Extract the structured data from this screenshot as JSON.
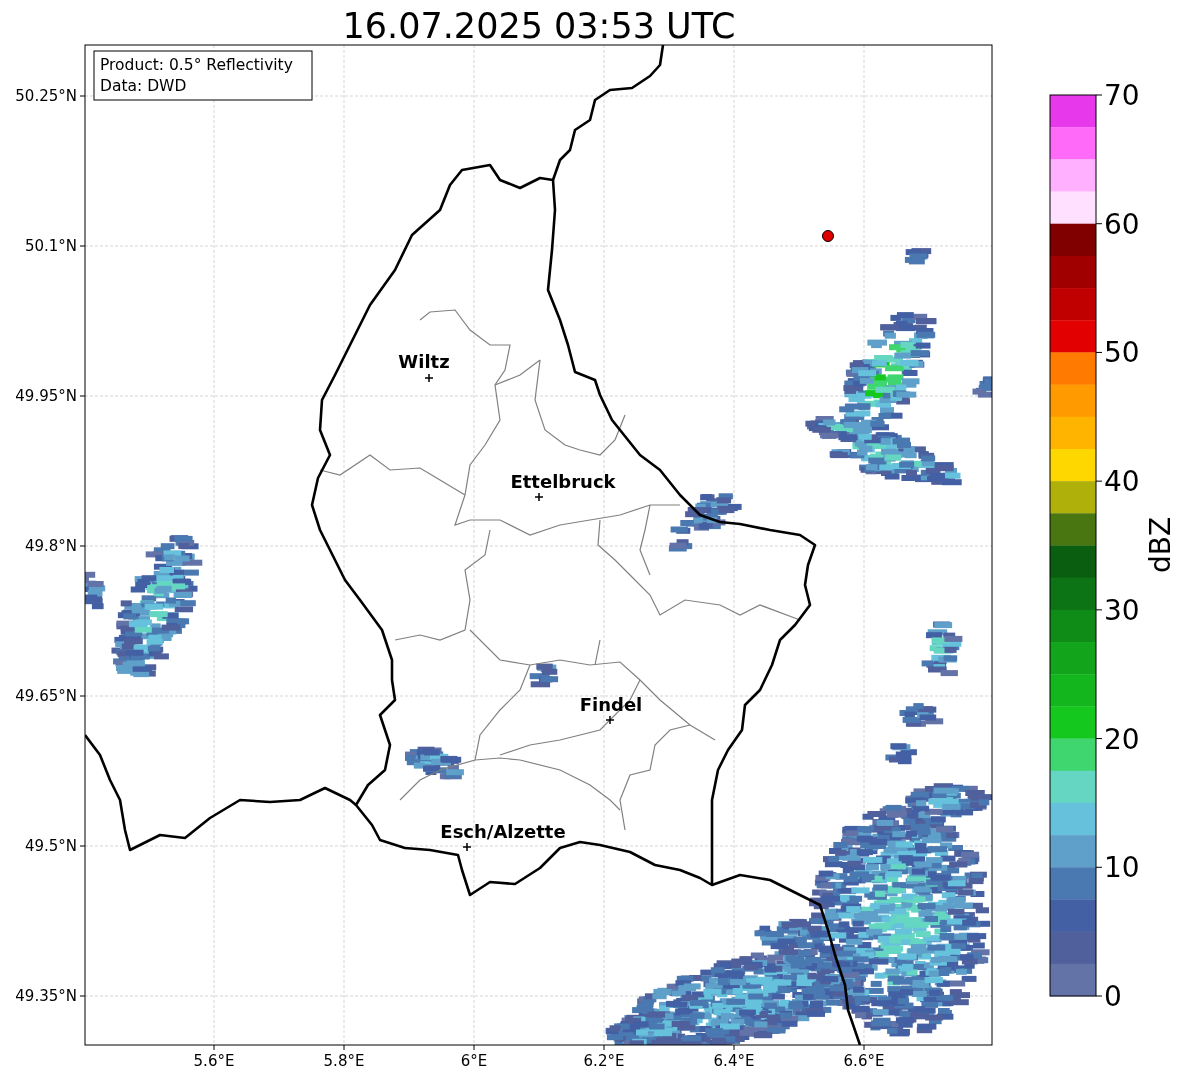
{
  "title": "16.07.2025 03:53 UTC",
  "info_box": [
    "Product: 0.5° Reflectivity",
    "Data: DWD"
  ],
  "map": {
    "cities": [
      {
        "name": "Wiltz"
      },
      {
        "name": "Ettelbruck"
      },
      {
        "name": "Findel"
      },
      {
        "name": "Esch/Alzette"
      }
    ],
    "x_ticks": [
      "5.6°E",
      "5.8°E",
      "6°E",
      "6.2°E",
      "6.4°E",
      "6.6°E"
    ],
    "y_ticks": [
      "50.25°N",
      "50.1°N",
      "49.95°N",
      "49.8°N",
      "49.65°N",
      "49.5°N",
      "49.35°N"
    ]
  },
  "colorbar": {
    "label": "dBZ",
    "ticks": [
      "70",
      "60",
      "50",
      "40",
      "30",
      "20",
      "10",
      "0"
    ],
    "segments": [
      {
        "color": "#e838ec"
      },
      {
        "color": "#ff6af8"
      },
      {
        "color": "#ffb0ff"
      },
      {
        "color": "#ffe0ff"
      },
      {
        "color": "#800000"
      },
      {
        "color": "#a00000"
      },
      {
        "color": "#c00000"
      },
      {
        "color": "#e20000"
      },
      {
        "color": "#ff7a00"
      },
      {
        "color": "#ff9a00"
      },
      {
        "color": "#ffb400"
      },
      {
        "color": "#ffd700"
      },
      {
        "color": "#b0b00a"
      },
      {
        "color": "#4a7612"
      },
      {
        "color": "#0a5e10"
      },
      {
        "color": "#0c7414"
      },
      {
        "color": "#0f8b18"
      },
      {
        "color": "#12a41a"
      },
      {
        "color": "#13b61c"
      },
      {
        "color": "#14c81e"
      },
      {
        "color": "#3fd66f"
      },
      {
        "color": "#64d6c2"
      },
      {
        "color": "#66c2dc"
      },
      {
        "color": "#5ea0c9"
      },
      {
        "color": "#4a78b0"
      },
      {
        "color": "#4260a3"
      },
      {
        "color": "#50609c"
      },
      {
        "color": "#6373a8"
      }
    ]
  }
}
